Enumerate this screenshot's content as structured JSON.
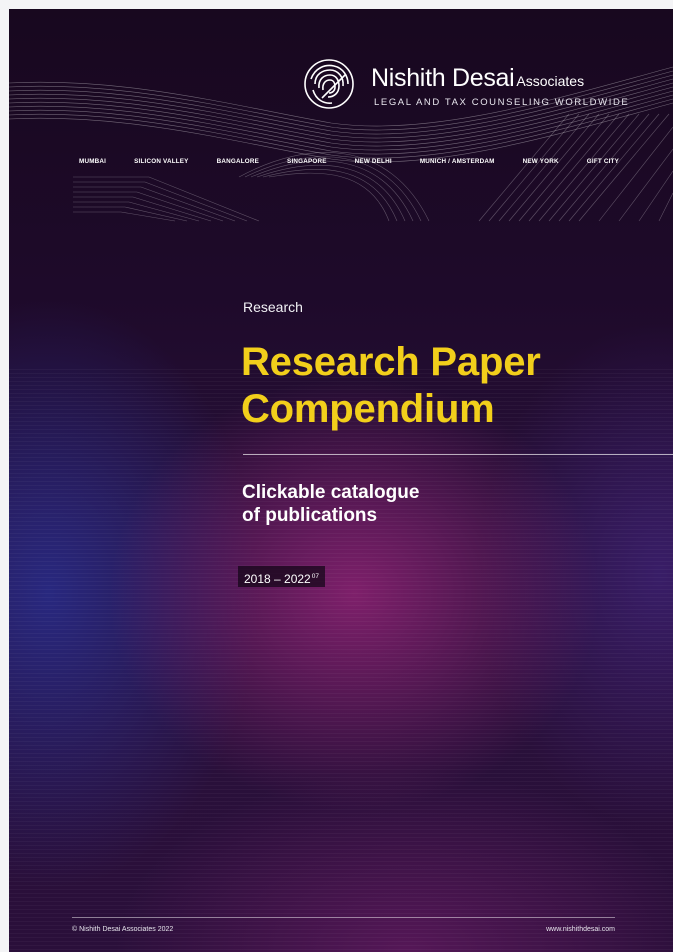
{
  "header": {
    "brand_name": "Nishith Desai",
    "brand_suffix": "Associates",
    "tagline": "LEGAL AND TAX COUNSELING WORLDWIDE",
    "cities": [
      "MUMBAI",
      "SILICON VALLEY",
      "BANGALORE",
      "SINGAPORE",
      "NEW DELHI",
      "MUNICH / AMSTERDAM",
      "NEW YORK",
      "GIFT CITY"
    ]
  },
  "cover": {
    "kicker": "Research",
    "title_line1": "Research Paper",
    "title_line2": "Compendium",
    "subtitle_line1": "Clickable catalogue",
    "subtitle_line2": "of publications",
    "date_range": "2018 – 2022",
    "date_superscript": "07"
  },
  "footer": {
    "copyright": "© Nishith Desai Associates 2022",
    "website": "www.nishithdesai.com"
  },
  "colors": {
    "title_yellow": "#f2cf1b",
    "background_dark": "#1e0a2a",
    "glow_magenta": "#962478",
    "glow_blue": "#283096"
  },
  "icons": {
    "logo": "fingerprint-emblem-icon"
  }
}
